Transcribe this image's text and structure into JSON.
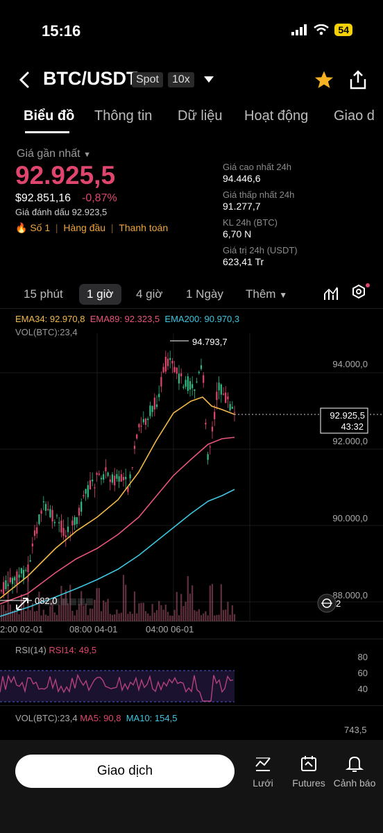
{
  "status": {
    "time": "15:16",
    "battery": "54"
  },
  "header": {
    "pair": "BTC/USDT",
    "tag_spot": "Spot",
    "tag_leverage": "10x"
  },
  "tabs": [
    "Biểu đồ",
    "Thông tin",
    "Dữ liệu",
    "Hoạt động",
    "Giao d"
  ],
  "price": {
    "last_label": "Giá gần nhất",
    "last": "92.925,5",
    "usd": "$92.851,16",
    "change": "-0,87%",
    "mark": "Giá đánh dấu 92.923,5",
    "badge_rank": "Số 1",
    "badge_top": "Hàng đầu",
    "badge_pay": "Thanh toán"
  },
  "stats": [
    {
      "label": "Giá cao nhất 24h",
      "value": "94.446,6"
    },
    {
      "label": "Giá thấp nhất 24h",
      "value": "91.277,7"
    },
    {
      "label": "KL 24h (BTC)",
      "value": "6,70 N"
    },
    {
      "label": "Giá trị 24h (USDT)",
      "value": "623,41 Tr"
    }
  ],
  "timeframes": [
    "15 phút",
    "1 giờ",
    "4 giờ",
    "1 Ngày",
    "Thêm"
  ],
  "chart": {
    "ema34": "EMA34: 92.970,8",
    "ema89": "EMA89: 92.323,5",
    "ema200": "EMA200: 90.970,3",
    "vol": "VOL(BTC):23,4",
    "high_label": "94.793,7",
    "low_label": "082,0",
    "price_tag": "92.925,5",
    "countdown": "43:32",
    "y_ticks": [
      "94.000,0",
      "92.000,0",
      "90.000,0",
      "88.000,0"
    ],
    "x_ticks": [
      "2:00 02-01",
      "08:00 04-01",
      "04:00 06-01"
    ],
    "layers_count": "2",
    "rsi_label": "RSI(14)",
    "rsi_value": "RSI14: 49,5",
    "rsi_ticks": [
      "80",
      "60",
      "40"
    ],
    "vol2": "VOL(BTC):23,4",
    "ma5": "MA5: 90,8",
    "ma10": "MA10: 154,5",
    "vol_max": "743,5"
  },
  "bottom": {
    "trade": "Giao dịch",
    "grid": "Lưới",
    "futures": "Futures",
    "alert": "Cảnh báo"
  },
  "colors": {
    "red": "#e0466d",
    "green": "#2ebd85",
    "ema34": "#f5b94a",
    "ema89": "#e8557a",
    "ema200": "#3ec6e0",
    "volume": "#d86b8a"
  }
}
